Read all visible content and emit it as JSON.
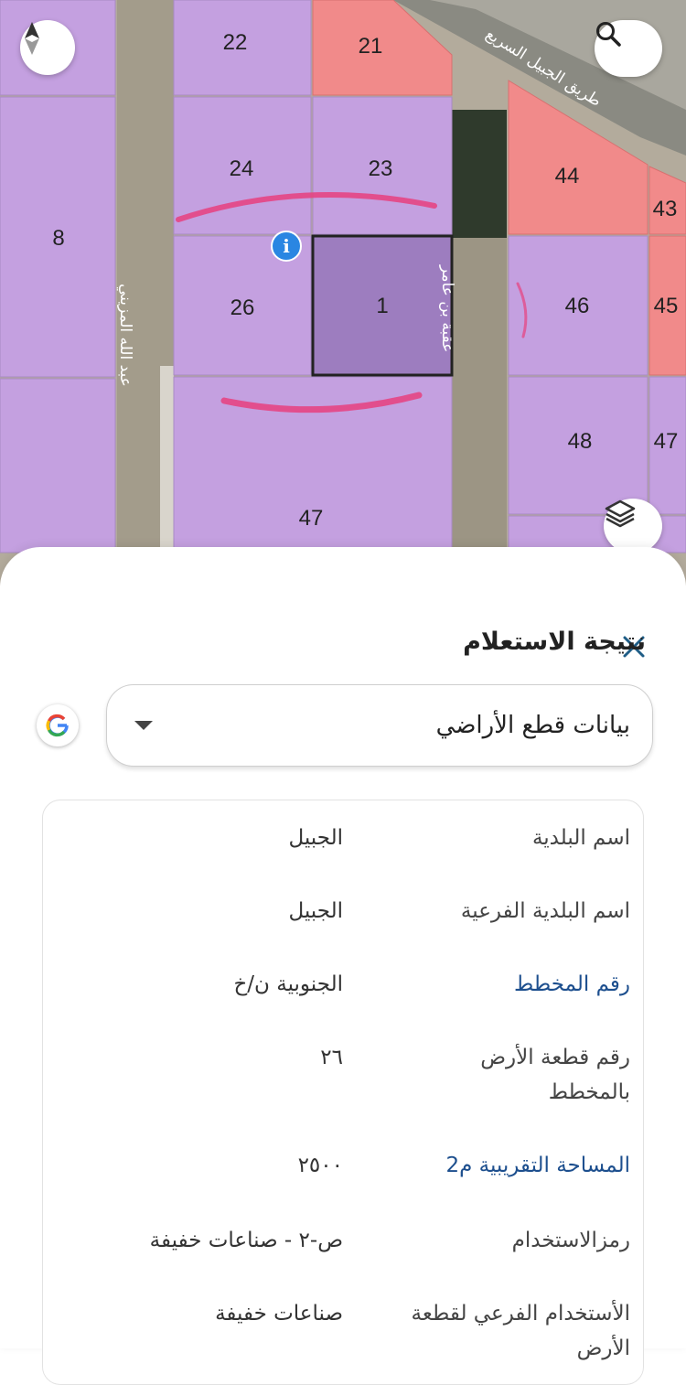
{
  "map": {
    "plots": [
      "22",
      "21",
      "24",
      "23",
      "8",
      "26",
      "1",
      "46",
      "45",
      "48",
      "47",
      "44",
      "43",
      "47"
    ],
    "streets": {
      "highway": "طريق الجبيل السريع",
      "west_street": "عبد الله المزيني",
      "east_street": "عقبة بن عامر"
    },
    "buttons": {
      "compass": "compass-icon",
      "search": "search-icon",
      "layers": "layers-icon",
      "info": "info-icon"
    },
    "colors": {
      "plot": "#c9a3e4",
      "highlight": "#f08080",
      "selected": "#9a7cc8"
    }
  },
  "sheet": {
    "title": "نتيجة الاستعلام",
    "close_icon": "close-icon",
    "dropdown_value": "بيانات قطع الأراضي",
    "google_icon": "google-icon",
    "rows": [
      {
        "label": "اسم البلدية",
        "value": "الجبيل"
      },
      {
        "label": "اسم البلدية الفرعية",
        "value": "الجبيل"
      },
      {
        "label": "رقم المخطط",
        "value": "الجنوبية ن/خ"
      },
      {
        "label": "رقم قطعة الأرض بالمخطط",
        "value": "٢٦"
      },
      {
        "label": "المساحة التقريبية م2",
        "value": "٢٥٠٠"
      },
      {
        "label": "رمزالاستخدام",
        "value": "ص-٢ - صناعات خفيفة"
      },
      {
        "label": "الأستخدام الفرعي لقطعة الأرض",
        "value": "صناعات خفيفة"
      }
    ]
  }
}
